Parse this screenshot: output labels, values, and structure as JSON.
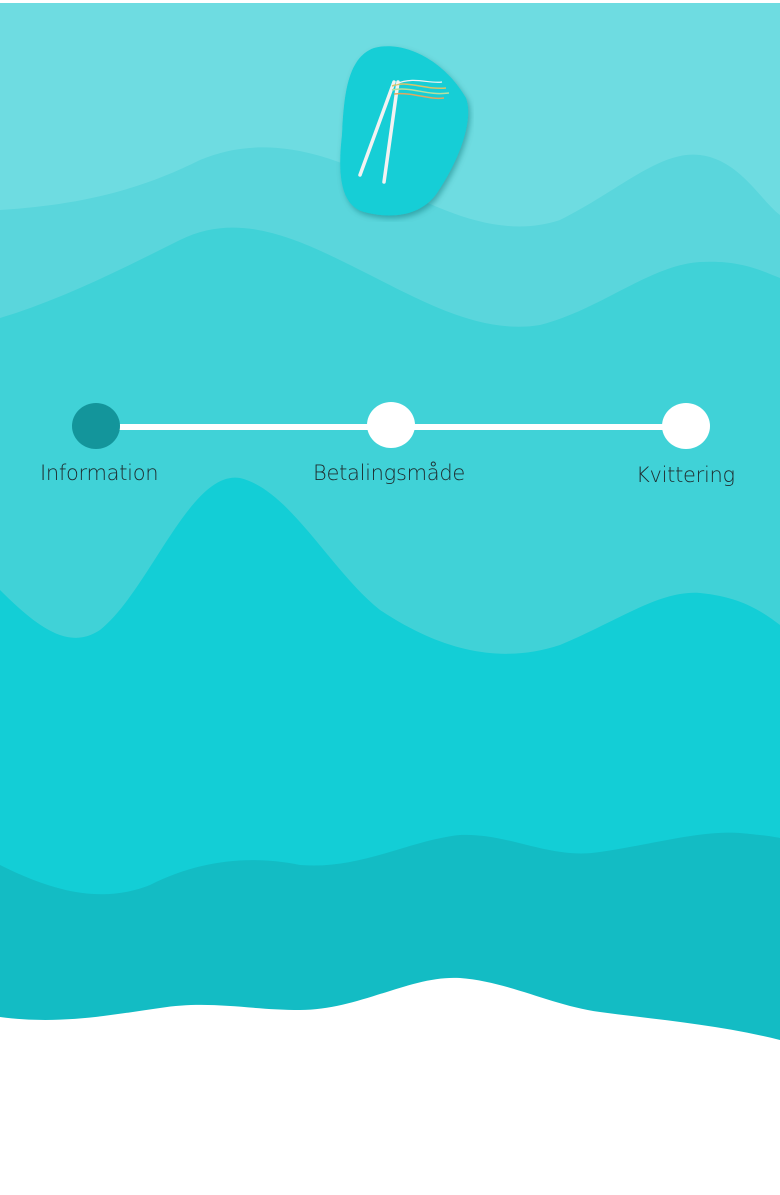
{
  "app": {
    "logo_icon": "kite-logo-icon"
  },
  "steps": [
    {
      "label": "Information",
      "state": "active"
    },
    {
      "label": "Betalingsmåde",
      "state": "inactive"
    },
    {
      "label": "Kvittering",
      "state": "inactive"
    }
  ],
  "colors": {
    "wave_lightest": "#6edce1",
    "wave_light": "#5ad6dc",
    "wave_mid": "#40d2d7",
    "wave_main": "#13ced6",
    "wave_dark": "#13bcc4",
    "active_step": "#13959b",
    "inactive_step": "#ffffff"
  }
}
